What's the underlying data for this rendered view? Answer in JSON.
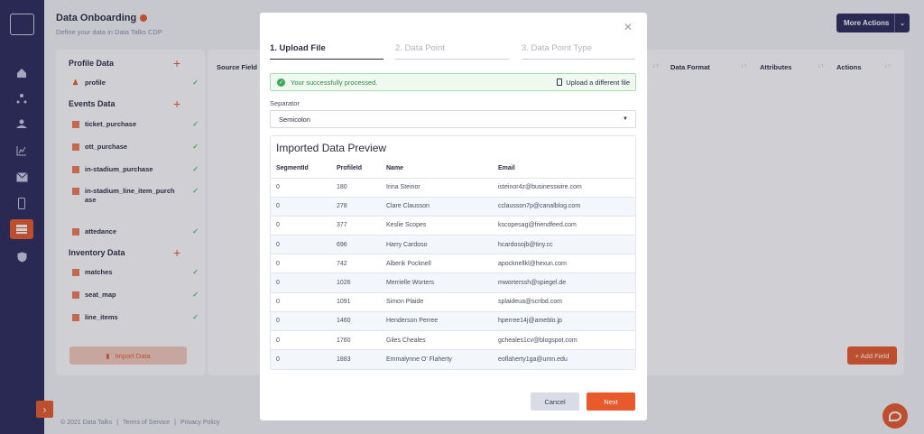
{
  "page": {
    "title": "Data Onboarding",
    "subtitle": "Define your data in Data Talks CDP",
    "more_actions": "More Actions"
  },
  "rail": {
    "icons": [
      "home-icon",
      "segment-icon",
      "audience-icon",
      "analytics-icon",
      "mail-icon",
      "mobile-icon",
      "data-onboarding-icon",
      "shield-icon"
    ]
  },
  "panel": {
    "profile_head": "Profile Data",
    "profile_items": [
      "profile"
    ],
    "events_head": "Events Data",
    "events_items": [
      "ticket_purchase",
      "ott_purchase",
      "in-stadium_purchase",
      "in-stadium_line_item_purchase",
      "attedance"
    ],
    "inventory_head": "Inventory Data",
    "inventory_items": [
      "matches",
      "seat_map",
      "line_items"
    ],
    "import_button": "Import Data"
  },
  "main": {
    "columns": [
      "Source Field",
      "Data Format",
      "Attributes",
      "Actions"
    ],
    "add_field": "+ Add Field"
  },
  "footer": {
    "copyright": "© 2021 Data Talks",
    "terms": "Terms of Service",
    "privacy": "Privacy Policy"
  },
  "modal": {
    "steps": [
      "1. Upload File",
      "2. Data Point",
      "3. Data Point Type"
    ],
    "success_msg": "Your successfully processed.",
    "upload_different": "Upload a different file",
    "separator_label": "Separator",
    "separator_value": "Semicolon",
    "preview_title": "Imported Data Preview",
    "table_headers": [
      "SegmentId",
      "ProfileId",
      "Name",
      "Email"
    ],
    "rows": [
      [
        "0",
        "180",
        "Irina Steinor",
        "isteinor4z@businesswire.com"
      ],
      [
        "0",
        "278",
        "Clare Clausson",
        "cclausson7p@canalblog.com"
      ],
      [
        "0",
        "377",
        "Keslie Scopes",
        "kscopesag@friendfeed.com"
      ],
      [
        "0",
        "696",
        "Harry Cardoso",
        "hcardosojb@tiny.cc"
      ],
      [
        "0",
        "742",
        "Alberik Pocknell",
        "apocknellkl@hexun.com"
      ],
      [
        "0",
        "1026",
        "Merrielle Worters",
        "mworterssh@spiegel.de"
      ],
      [
        "0",
        "1091",
        "Simon Plaide",
        "splaideua@scribd.com"
      ],
      [
        "0",
        "1460",
        "Henderson Perree",
        "hperree14j@ameblo.jp"
      ],
      [
        "0",
        "1760",
        "Giles Cheales",
        "gcheales1cv@blogspot.com"
      ],
      [
        "0",
        "1883",
        "Emmalynne O' Flaherty",
        "eoflaherty1ga@umn.edu"
      ]
    ],
    "cancel": "Cancel",
    "next": "Next"
  },
  "colors": {
    "accent": "#e85a2b",
    "nav": "#2b2a5c",
    "success": "#3ea85a"
  }
}
